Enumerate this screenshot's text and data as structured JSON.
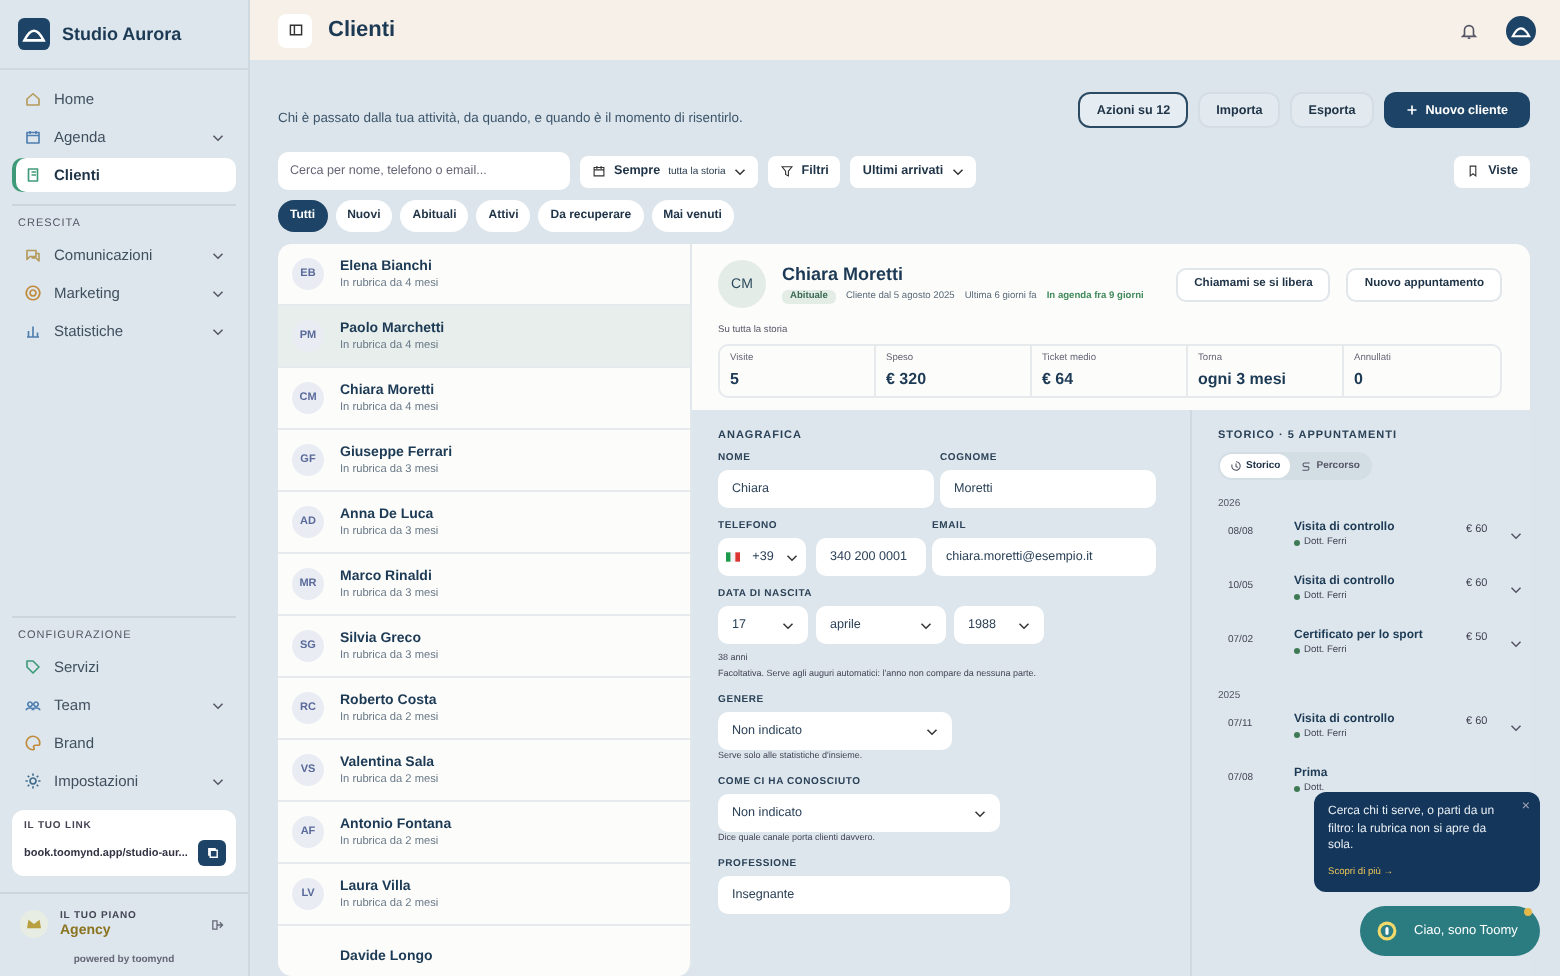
{
  "sidebar": {
    "brand": "Studio Aurora",
    "sections": [
      {
        "items": [
          {
            "label": "Home",
            "expandable": false,
            "selected": false
          },
          {
            "label": "Agenda",
            "expandable": true,
            "selected": false
          },
          {
            "label": "Clienti",
            "expandable": false,
            "selected": true
          }
        ]
      },
      {
        "title": "CRESCITA",
        "items": [
          {
            "label": "Comunicazioni",
            "expandable": true,
            "selected": false
          },
          {
            "label": "Marketing",
            "expandable": true,
            "selected": false
          },
          {
            "label": "Statistiche",
            "expandable": true,
            "selected": false
          }
        ]
      },
      {
        "title": "CONFIGURAZIONE",
        "items": [
          {
            "label": "Servizi",
            "expandable": false,
            "selected": false
          },
          {
            "label": "Team",
            "expandable": true,
            "selected": false
          },
          {
            "label": "Brand",
            "expandable": false,
            "selected": false
          },
          {
            "label": "Impostazioni",
            "expandable": true,
            "selected": false
          }
        ]
      }
    ],
    "link": {
      "title": "IL TUO LINK",
      "url": "book.toomynd.app/studio-aur..."
    },
    "plan": {
      "title": "IL TUO PIANO",
      "name": "Agency"
    },
    "powered": "powered by toomynd"
  },
  "header": {
    "title": "Clienti"
  },
  "intro": "Chi è passato dalla tua attività, da quando, e quando è il momento di risentirlo.",
  "actions": [
    {
      "label": "Azioni su 12",
      "kind": "outline"
    },
    {
      "label": "Importa",
      "kind": "plain"
    },
    {
      "label": "Esporta",
      "kind": "plain"
    },
    {
      "label": "Nuovo cliente",
      "kind": "primary"
    }
  ],
  "toolbar": {
    "search": {
      "placeholder": "Cerca per nome, telefono o email..."
    },
    "period": {
      "label": "Sempre",
      "note": "tutta la storia"
    },
    "filters": "Filtri",
    "sort": "Ultimi arrivati",
    "views": "Viste"
  },
  "chips": [
    {
      "label": "Tutti",
      "selected": true
    },
    {
      "label": "Nuovi",
      "selected": false
    },
    {
      "label": "Abituali",
      "selected": false
    },
    {
      "label": "Attivi",
      "selected": false
    },
    {
      "label": "Da recuperare",
      "selected": false
    },
    {
      "label": "Mai venuti",
      "selected": false
    }
  ],
  "clients": [
    {
      "initials": "EB",
      "name": "Elena Bianchi",
      "since": "In rubrica da 4 mesi",
      "selected": false
    },
    {
      "initials": "PM",
      "name": "Paolo Marchetti",
      "since": "In rubrica da 4 mesi",
      "selected": true
    },
    {
      "initials": "CM",
      "name": "Chiara Moretti",
      "since": "In rubrica da 4 mesi",
      "selected": false
    },
    {
      "initials": "GF",
      "name": "Giuseppe Ferrari",
      "since": "In rubrica da 3 mesi",
      "selected": false
    },
    {
      "initials": "AD",
      "name": "Anna De Luca",
      "since": "In rubrica da 3 mesi",
      "selected": false
    },
    {
      "initials": "MR",
      "name": "Marco Rinaldi",
      "since": "In rubrica da 3 mesi",
      "selected": false
    },
    {
      "initials": "SG",
      "name": "Silvia Greco",
      "since": "In rubrica da 3 mesi",
      "selected": false
    },
    {
      "initials": "RC",
      "name": "Roberto Costa",
      "since": "In rubrica da 2 mesi",
      "selected": false
    },
    {
      "initials": "VS",
      "name": "Valentina Sala",
      "since": "In rubrica da 2 mesi",
      "selected": false
    },
    {
      "initials": "AF",
      "name": "Antonio Fontana",
      "since": "In rubrica da 2 mesi",
      "selected": false
    },
    {
      "initials": "LV",
      "name": "Laura Villa",
      "since": "In rubrica da 2 mesi",
      "selected": false
    },
    {
      "name": "Davide Longo",
      "selected": false
    }
  ],
  "detail": {
    "initials": "CM",
    "name": "Chiara Moretti",
    "badge": "Abituale",
    "meta": [
      {
        "text": "Cliente dal 5 agosto 2025",
        "kind": "plain"
      },
      {
        "text": "Ultima 6 giorni fa",
        "kind": "plain"
      },
      {
        "text": "In agenda fra 9 giorni",
        "kind": "accent"
      }
    ],
    "buttons": [
      "Chiamami se si libera",
      "Nuovo appuntamento"
    ],
    "stats_caption": "Su tutta la storia",
    "stats": [
      {
        "label": "Visite",
        "value": "5"
      },
      {
        "label": "Speso",
        "value": "€ 320"
      },
      {
        "label": "Ticket medio",
        "value": "€ 64"
      },
      {
        "label": "Torna",
        "value": "ogni 3 mesi"
      },
      {
        "label": "Annullati",
        "value": "0"
      }
    ]
  },
  "form": {
    "title": "ANAGRAFICA",
    "nome": {
      "label": "NOME",
      "value": "Chiara"
    },
    "cognome": {
      "label": "COGNOME",
      "value": "Moretti"
    },
    "telefono": {
      "label": "TELEFONO",
      "prefix": "+39",
      "number": "340 200 0001"
    },
    "email": {
      "label": "EMAIL",
      "value": "chiara.moretti@esempio.it"
    },
    "nascita": {
      "label": "DATA DI NASCITA",
      "day": "17",
      "month": "aprile",
      "year": "1988",
      "age": "38 anni",
      "hint": "Facoltativa. Serve agli auguri automatici: l'anno non compare da nessuna parte."
    },
    "genere": {
      "label": "GENERE",
      "value": "Non indicato",
      "hint": "Serve solo alle statistiche d'insieme."
    },
    "conosciuto": {
      "label": "COME CI HA CONOSCIUTO",
      "value": "Non indicato",
      "hint": "Dice quale canale porta clienti davvero."
    },
    "professione": {
      "label": "PROFESSIONE",
      "value": "Insegnante"
    }
  },
  "history": {
    "title": "STORICO · 5 APPUNTAMENTI",
    "tabs": [
      {
        "label": "Storico",
        "selected": true
      },
      {
        "label": "Percorso",
        "selected": false
      }
    ],
    "groups": [
      {
        "year": "2026",
        "items": [
          {
            "date": "08/08",
            "title": "Visita di controllo",
            "doctor": "Dott. Ferri",
            "price": "€ 60"
          },
          {
            "date": "10/05",
            "title": "Visita di controllo",
            "doctor": "Dott. Ferri",
            "price": "€ 60"
          },
          {
            "date": "07/02",
            "title": "Certificato per lo sport",
            "doctor": "Dott. Ferri",
            "price": "€ 50"
          }
        ]
      },
      {
        "year": "2025",
        "items": [
          {
            "date": "07/11",
            "title": "Visita di controllo",
            "doctor": "Dott. Ferri",
            "price": "€ 60"
          },
          {
            "date": "07/08",
            "title": "Prima",
            "doctor": "Dott."
          }
        ]
      }
    ]
  },
  "tip": {
    "text": "Cerca chi ti serve, o parti da un filtro: la rubrica non si apre da sola.",
    "link": "Scopri di più →",
    "close": "×"
  },
  "assistant": {
    "label": "Ciao, sono Toomy",
    "notification": true
  }
}
